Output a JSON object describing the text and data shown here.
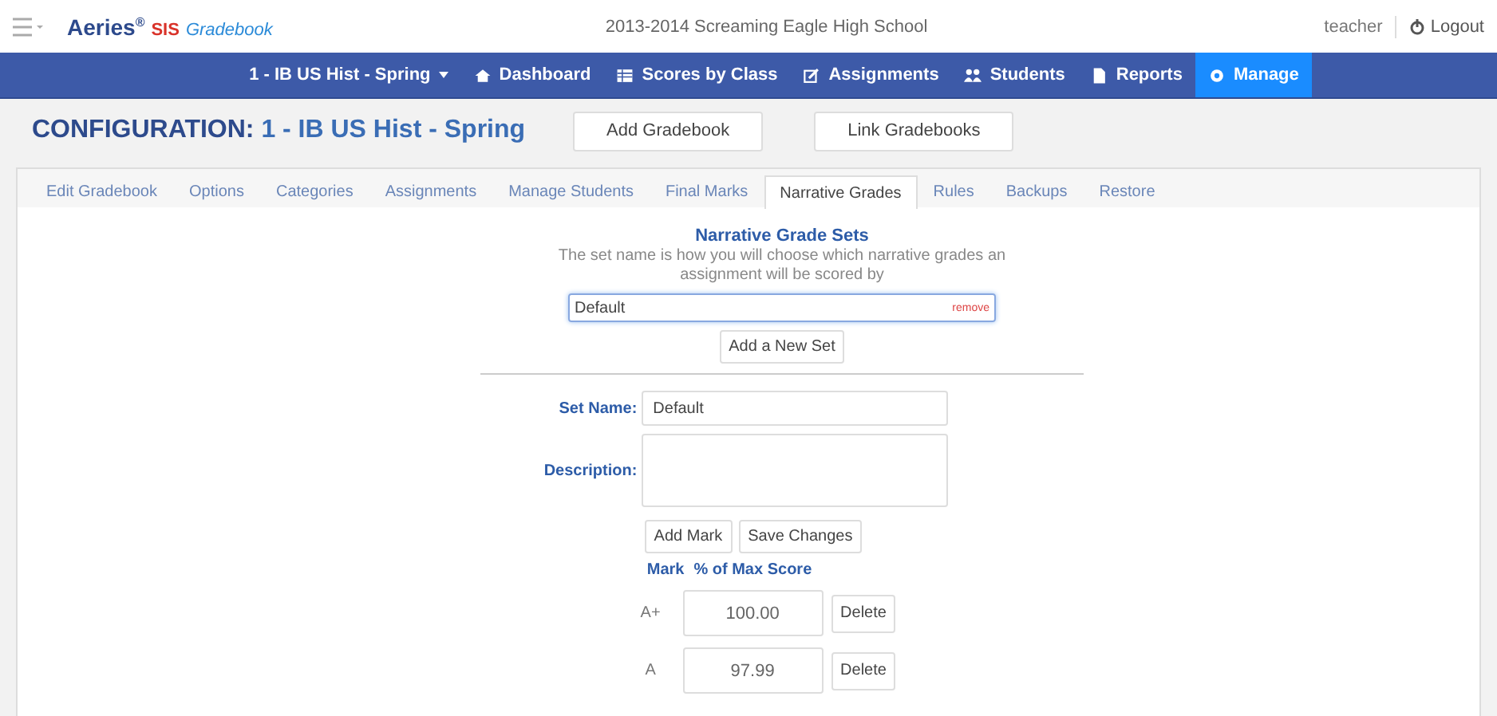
{
  "brand": {
    "name": "Aeries",
    "mark": "®",
    "sis": "SIS",
    "product": "Gradebook"
  },
  "school": "2013-2014 Screaming Eagle High School",
  "user": {
    "name": "teacher",
    "logout": "Logout"
  },
  "nav": [
    {
      "label": "1 - IB US Hist - Spring",
      "kind": "dropdown",
      "selected": false
    },
    {
      "label": "Dashboard",
      "kind": "home",
      "selected": false
    },
    {
      "label": "Scores by Class",
      "kind": "grid",
      "selected": false
    },
    {
      "label": "Assignments",
      "kind": "edit",
      "selected": false
    },
    {
      "label": "Students",
      "kind": "people",
      "selected": false
    },
    {
      "label": "Reports",
      "kind": "doc",
      "selected": false
    },
    {
      "label": "Manage",
      "kind": "gear",
      "selected": true
    }
  ],
  "header": {
    "prefix": "CONFIGURATION:",
    "title": "1 - IB US Hist - Spring",
    "buttons": [
      "Add Gradebook",
      "Link Gradebooks"
    ]
  },
  "tabs": [
    {
      "label": "Edit Gradebook",
      "selected": false
    },
    {
      "label": "Options",
      "selected": false
    },
    {
      "label": "Categories",
      "selected": false
    },
    {
      "label": "Assignments",
      "selected": false
    },
    {
      "label": "Manage Students",
      "selected": false
    },
    {
      "label": "Final Marks",
      "selected": false
    },
    {
      "label": "Narrative Grades",
      "selected": true
    },
    {
      "label": "Rules",
      "selected": false
    },
    {
      "label": "Backups",
      "selected": false
    },
    {
      "label": "Restore",
      "selected": false
    }
  ],
  "narrative": {
    "heading": "Narrative Grade Sets",
    "description": "The set name is how you will choose which narrative grades an assignment will be scored by",
    "set_select": {
      "value": "Default",
      "remove": "remove"
    },
    "add_set": "Add a New Set",
    "set_name": {
      "label": "Set Name:",
      "value": "Default"
    },
    "set_description": {
      "label": "Description:"
    },
    "buttons": [
      "Add Mark",
      "Save Changes"
    ],
    "columns": [
      "Mark",
      "% of Max Score"
    ],
    "marks": [
      {
        "mark": "A+",
        "score": "100.00",
        "action": "Delete"
      },
      {
        "mark": "A",
        "score": "97.99",
        "action": "Delete"
      }
    ]
  }
}
